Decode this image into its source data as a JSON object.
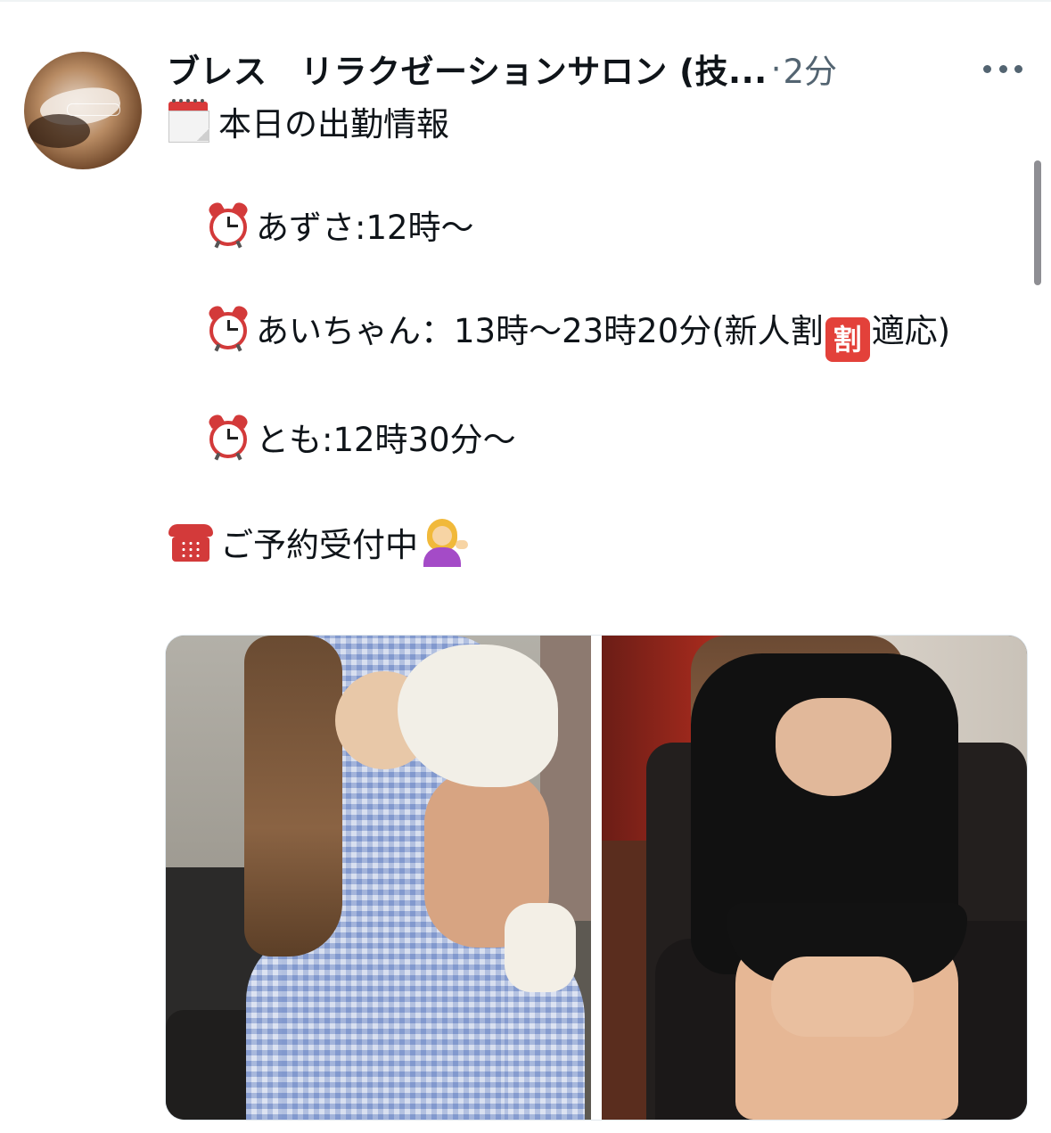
{
  "tweet": {
    "author_name": "ブレス　リラクゼーションサロン (技...",
    "separator": "·",
    "time": "2分",
    "more_label": "…",
    "lines": {
      "heading": "本日の出勤情報",
      "azusa": "あずさ:12時〜",
      "ai_part1": "あいちゃん：13時〜23時20分(新人割",
      "wari_badge": "割",
      "ai_part2": "適応)",
      "tomo": "とも:12時30分〜",
      "reservation": "ご予約受付中"
    },
    "icons": {
      "calendar": "calendar-icon",
      "alarm": "alarm-clock-icon",
      "telephone": "telephone-icon",
      "person": "person-tipping-hand-icon",
      "more": "more-icon"
    },
    "colors": {
      "text": "#0f1419",
      "secondary": "#536471",
      "accent_red": "#e3413a"
    }
  }
}
